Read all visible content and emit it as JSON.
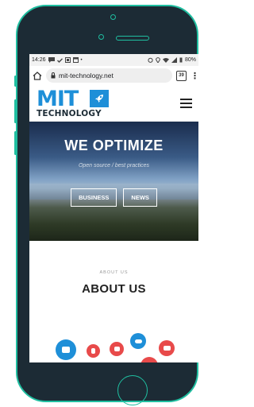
{
  "status_bar": {
    "time": "14:26",
    "battery": "80%"
  },
  "browser": {
    "url": "mit-technology.net",
    "tab_count": "39"
  },
  "site": {
    "logo_primary": "MIT",
    "logo_secondary": "TECHNOLOGY"
  },
  "hero": {
    "title": "WE OPTIMIZE",
    "subtitle": "Open source / best practices",
    "buttons": [
      "BUSINESS",
      "NEWS"
    ]
  },
  "about": {
    "kicker": "ABOUT US",
    "title": "ABOUT US"
  },
  "colors": {
    "phone_body": "#1c2b35",
    "phone_accent": "#1fbea0",
    "brand_blue": "#1e8fd8",
    "bubble_red": "#e84a4a"
  }
}
